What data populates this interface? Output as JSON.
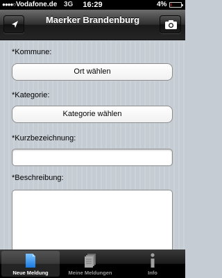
{
  "status_bar": {
    "signal": "●●●●○",
    "carrier": "Vodafone.de",
    "network": "3G",
    "time": "16:29",
    "battery_percent": "4%",
    "battery_level": 0.04,
    "battery_color": "#e00000"
  },
  "navbar": {
    "title": "Maerker Brandenburg",
    "left_icon": "location-arrow-icon",
    "right_icon": "camera-icon"
  },
  "form": {
    "kommune_label": "*Kommune:",
    "kommune_button": "Ort wählen",
    "kategorie_label": "*Kategorie:",
    "kategorie_button": "Kategorie wählen",
    "kurz_label": "*Kurzbezeichnung:",
    "kurz_value": "",
    "beschreibung_label": "*Beschreibung:",
    "beschreibung_value": ""
  },
  "tabs": [
    {
      "label": "Neue Meldung",
      "icon": "document-icon",
      "active": true
    },
    {
      "label": "Meine Meldungen",
      "icon": "document-stack-icon",
      "active": false
    },
    {
      "label": "Info",
      "icon": "info-icon",
      "active": false
    }
  ]
}
